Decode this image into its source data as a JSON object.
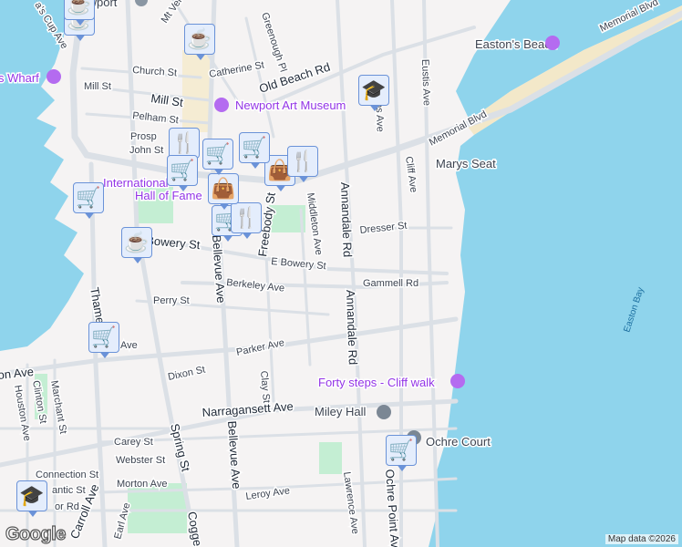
{
  "map": {
    "colors": {
      "water": "#8fd4ec",
      "land": "#f5f3f3",
      "road": "#dbe0e6",
      "park": "#c4eed3",
      "beach": "#f5ecd3",
      "marker_bg": "#e4edfc",
      "marker_border": "#6a92d8",
      "icon": "#0c3f63",
      "poi": "#9334e6"
    },
    "streets": [
      "Mill St",
      "Mill St",
      "Church St",
      "Catherine St",
      "Old Beach Rd",
      "Pelham St",
      "Prosp",
      "John St",
      "Greenough Pl",
      "Mt Ver",
      "Gibbs Ave",
      "Eustis Ave",
      "Memorial Blvd",
      "Memorial Blvd",
      "Cliff Ave",
      "Dresser St",
      "Middleton Ave",
      "Annandale Rd",
      "Annandale Rd",
      "Freebody St",
      "Bowery St",
      "E Bowery St",
      "Berkeley Ave",
      "Gammell Rd",
      "Perry St",
      "Thames St",
      "Bellevue Ave",
      "Bellevue Ave",
      "Parker Ave",
      "Dixon St",
      "Clay St",
      "Narragansett Ave",
      "Carey St",
      "Webster St",
      "Connection St",
      "Morton Ave",
      "Leroy Ave",
      "Spring St",
      "Cogge",
      "Carroll Ave",
      "Earl Ave",
      "Lawrence Ave",
      "Ochre Point Ave",
      "Marchant St",
      "Clinton St",
      "Houston Ave",
      "on Ave",
      "a's Cup Ave",
      "Ave",
      "antic St",
      "or Rd"
    ],
    "water_labels": [
      "Easton Bay"
    ],
    "places": {
      "newport": "Newport",
      "art_museum": "Newport Art Museum",
      "eastons_beach": "Easton's Beach",
      "marys_seat": "Marys Seat",
      "forty_steps": "Forty steps - Cliff walk",
      "miley_hall": "Miley Hall",
      "ochre_court": "Ochre Court",
      "wharf": "s Wharf",
      "tennis_1": "International",
      "tennis_2": "Hall of Fame"
    },
    "markers": [
      {
        "type": "coffee",
        "icon": "coffee-icon"
      },
      {
        "type": "coffee",
        "icon": "coffee-icon"
      },
      {
        "type": "coffee",
        "icon": "coffee-icon"
      },
      {
        "type": "shopping",
        "icon": "shopping-cart-icon"
      },
      {
        "type": "shopping",
        "icon": "shopping-cart-icon"
      },
      {
        "type": "shopping",
        "icon": "shopping-cart-icon"
      },
      {
        "type": "restaurant",
        "icon": "restaurant-icon"
      },
      {
        "type": "shopping",
        "icon": "shopping-cart-icon"
      },
      {
        "type": "shopping",
        "icon": "shopping-cart-icon"
      },
      {
        "type": "restaurant",
        "icon": "restaurant-icon"
      },
      {
        "type": "store",
        "icon": "shopping-bag-icon"
      },
      {
        "type": "store",
        "icon": "shopping-bag-icon"
      },
      {
        "type": "restaurant",
        "icon": "restaurant-icon"
      },
      {
        "type": "school",
        "icon": "school-icon"
      },
      {
        "type": "school",
        "icon": "school-icon"
      },
      {
        "type": "shopping",
        "icon": "shopping-cart-icon"
      },
      {
        "type": "shopping",
        "icon": "shopping-cart-icon"
      },
      {
        "type": "coffee",
        "icon": "coffee-icon"
      }
    ],
    "attribution": "Map data ©2026",
    "logo": "Google"
  }
}
